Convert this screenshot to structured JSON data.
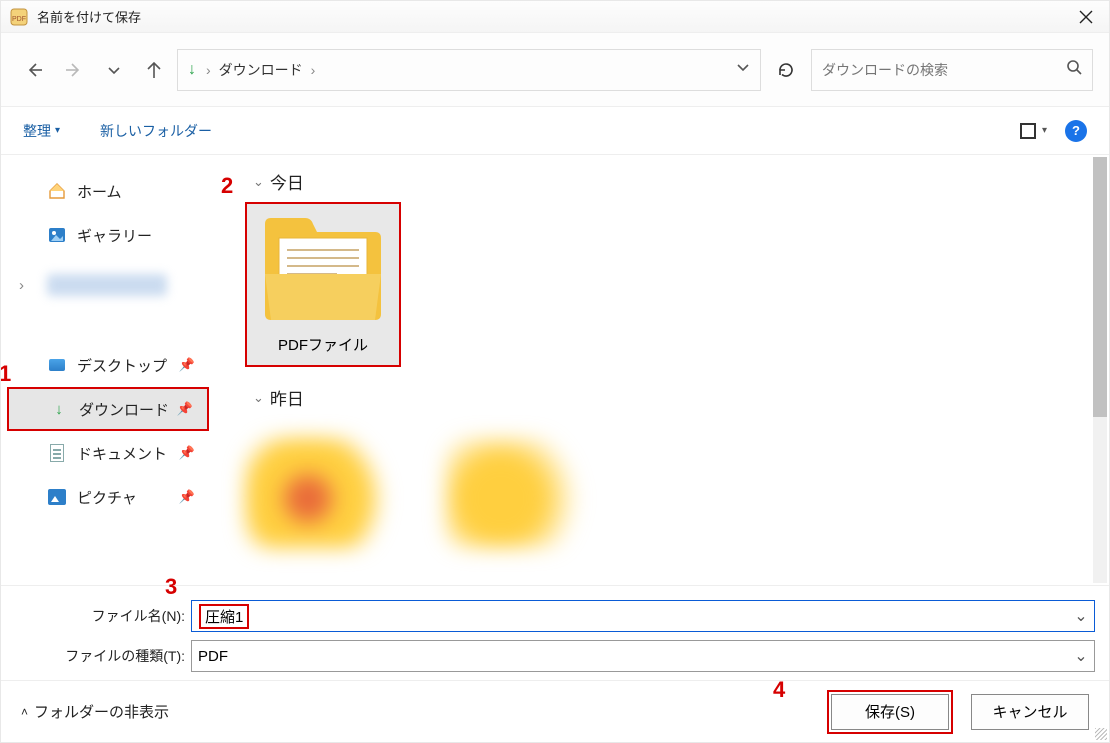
{
  "title": "名前を付けて保存",
  "breadcrumb": {
    "current": "ダウンロード"
  },
  "search": {
    "placeholder": "ダウンロードの検索"
  },
  "toolbar": {
    "organize": "整理",
    "new_folder": "新しいフォルダー"
  },
  "sidebar": {
    "home": "ホーム",
    "gallery": "ギャラリー",
    "desktop": "デスクトップ",
    "downloads": "ダウンロード",
    "documents": "ドキュメント",
    "pictures": "ピクチャ"
  },
  "content": {
    "groups": {
      "today": "今日",
      "yesterday": "昨日"
    },
    "selected_folder": "PDFファイル"
  },
  "fields": {
    "filename_label": "ファイル名(N):",
    "filetype_label": "ファイルの種類(T):",
    "filename_value": "圧縮1",
    "filetype_value": "PDF"
  },
  "footer": {
    "hide_folders": "フォルダーの非表示",
    "save": "保存(S)",
    "cancel": "キャンセル"
  },
  "annotations": {
    "a1": "1",
    "a2": "2",
    "a3": "3",
    "a4": "4"
  }
}
